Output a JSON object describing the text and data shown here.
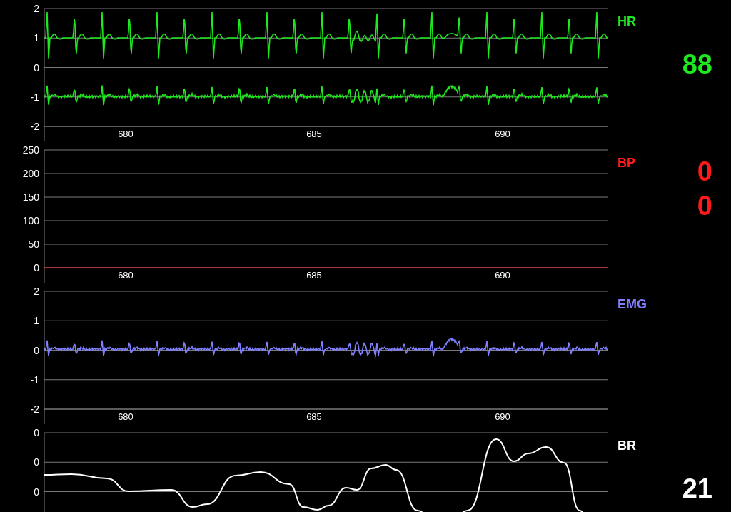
{
  "panels": [
    {
      "kind": "ecg",
      "label": "HR",
      "color": "#1ee81e",
      "values": [
        "88"
      ],
      "y_ticks": [
        "2",
        "1",
        "0",
        "-1",
        "-2"
      ],
      "x_ticks": [
        "680",
        "685",
        "690"
      ]
    },
    {
      "kind": "flat",
      "label": "BP",
      "color": "#ff1a1a",
      "values": [
        "0",
        "0"
      ],
      "y_ticks": [
        "250",
        "200",
        "150",
        "100",
        "50",
        "0"
      ],
      "x_ticks": [
        "680",
        "685",
        "690"
      ]
    },
    {
      "kind": "emg",
      "label": "EMG",
      "color": "#8080ff",
      "y_ticks": [
        "2",
        "1",
        "0",
        "-1",
        "-2"
      ],
      "x_ticks": [
        "680",
        "685",
        "690"
      ]
    },
    {
      "kind": "resp",
      "label": "BR",
      "color": "#ffffff",
      "values": [
        "21"
      ],
      "y_ticks": [
        "0",
        "0",
        "0"
      ]
    }
  ]
}
